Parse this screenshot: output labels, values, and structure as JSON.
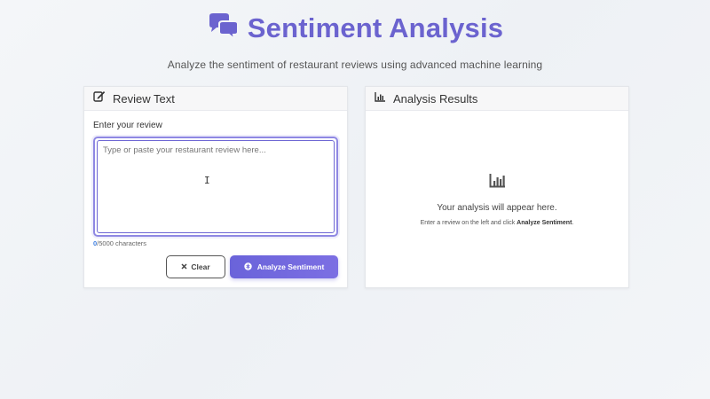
{
  "header": {
    "title": "Sentiment Analysis",
    "subtitle": "Analyze the sentiment of restaurant reviews using advanced machine learning",
    "icon": "comments-icon",
    "accent_color": "#6b63cf"
  },
  "review_panel": {
    "title": "Review Text",
    "icon": "edit-icon",
    "field_label": "Enter your review",
    "textarea_value": "",
    "textarea_placeholder": "Type or paste your restaurant review here...",
    "char_count": "0",
    "char_limit_text": "/5000 characters",
    "clear_label": "Clear",
    "clear_icon": "close-icon",
    "analyze_label": "Analyze Sentiment",
    "analyze_icon": "brain-icon",
    "analyze_color": "#6a63da"
  },
  "results_panel": {
    "title": "Analysis Results",
    "icon": "chart-icon",
    "empty_icon": "chart-icon",
    "empty_main": "Your analysis will appear here.",
    "empty_sub_prefix": "Enter a review on the left and click ",
    "empty_sub_bold": "Analyze Sentiment",
    "empty_sub_suffix": "."
  }
}
